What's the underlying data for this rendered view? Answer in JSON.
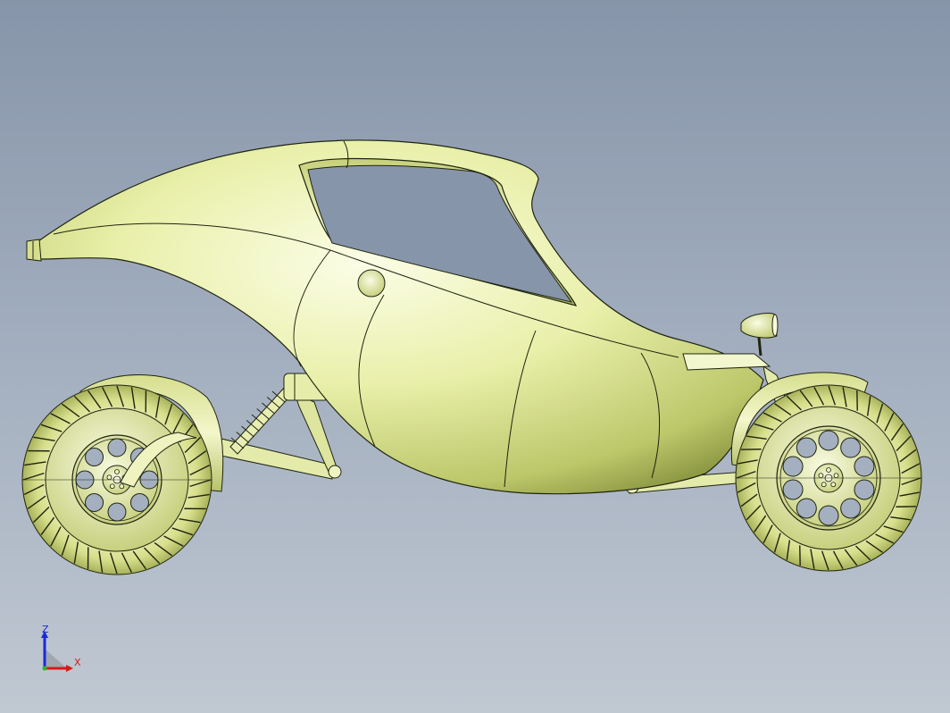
{
  "viewport": {
    "background_top": "#8795aa",
    "background_bottom": "#c0c8d2",
    "model_color": "#e8efa6",
    "edge_color": "#1f2410"
  },
  "triad": {
    "z_label": "Z",
    "x_label": "X",
    "z_color": "#1a2bd6",
    "x_color": "#d61a1a",
    "y_color": "#2bb52b"
  }
}
